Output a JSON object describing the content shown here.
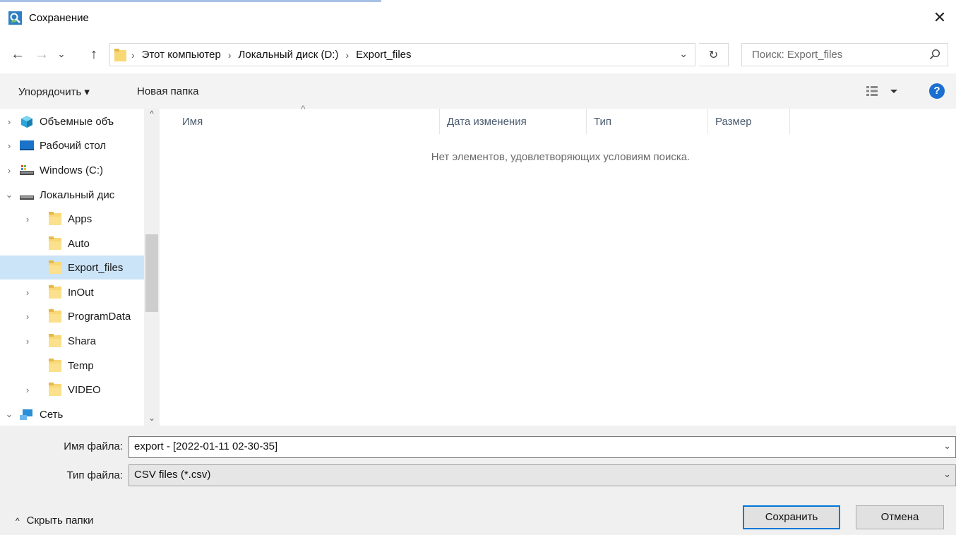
{
  "window": {
    "title": "Сохранение"
  },
  "address": {
    "crumbs": [
      "Этот компьютер",
      "Локальный диск (D:)",
      "Export_files"
    ]
  },
  "search": {
    "placeholder": "Поиск: Export_files"
  },
  "toolbar": {
    "organize": "Упорядочить ▾",
    "new_folder": "Новая папка"
  },
  "tree": {
    "items": [
      {
        "label": "Объемные объ",
        "chevron": "›",
        "icon": "3d-objects-icon"
      },
      {
        "label": "Рабочий стол",
        "chevron": "›",
        "icon": "desktop-icon"
      },
      {
        "label": "Windows (C:)",
        "chevron": "›",
        "icon": "drive-c-icon"
      },
      {
        "label": "Локальный дис",
        "chevron": "⌄",
        "icon": "drive-d-icon"
      },
      {
        "label": "Apps",
        "chevron": "›",
        "icon": "folder-icon"
      },
      {
        "label": "Auto",
        "chevron": "",
        "icon": "folder-icon"
      },
      {
        "label": "Export_files",
        "chevron": "",
        "icon": "folder-icon",
        "selected": true
      },
      {
        "label": "InOut",
        "chevron": "›",
        "icon": "folder-icon"
      },
      {
        "label": "ProgramData",
        "chevron": "›",
        "icon": "folder-icon"
      },
      {
        "label": "Shara",
        "chevron": "›",
        "icon": "folder-icon"
      },
      {
        "label": "Temp",
        "chevron": "",
        "icon": "folder-icon"
      },
      {
        "label": "VIDEO",
        "chevron": "›",
        "icon": "folder-icon"
      },
      {
        "label": "Сеть",
        "chevron": "⌄",
        "icon": "network-icon"
      }
    ]
  },
  "list": {
    "columns": [
      "Имя",
      "Дата изменения",
      "Тип",
      "Размер"
    ],
    "empty_message": "Нет элементов, удовлетворяющих условиям поиска."
  },
  "form": {
    "filename_label": "Имя файла:",
    "filename_value": "export - [2022-01-11 02-30-35]",
    "filetype_label": "Тип файла:",
    "filetype_value": "CSV files (*.csv)"
  },
  "footer": {
    "hide_folders": "Скрыть папки",
    "save": "Сохранить",
    "cancel": "Отмена"
  },
  "colors": {
    "accent": "#0078d7",
    "selection": "#cce4f7",
    "folder": "#f8d775"
  }
}
